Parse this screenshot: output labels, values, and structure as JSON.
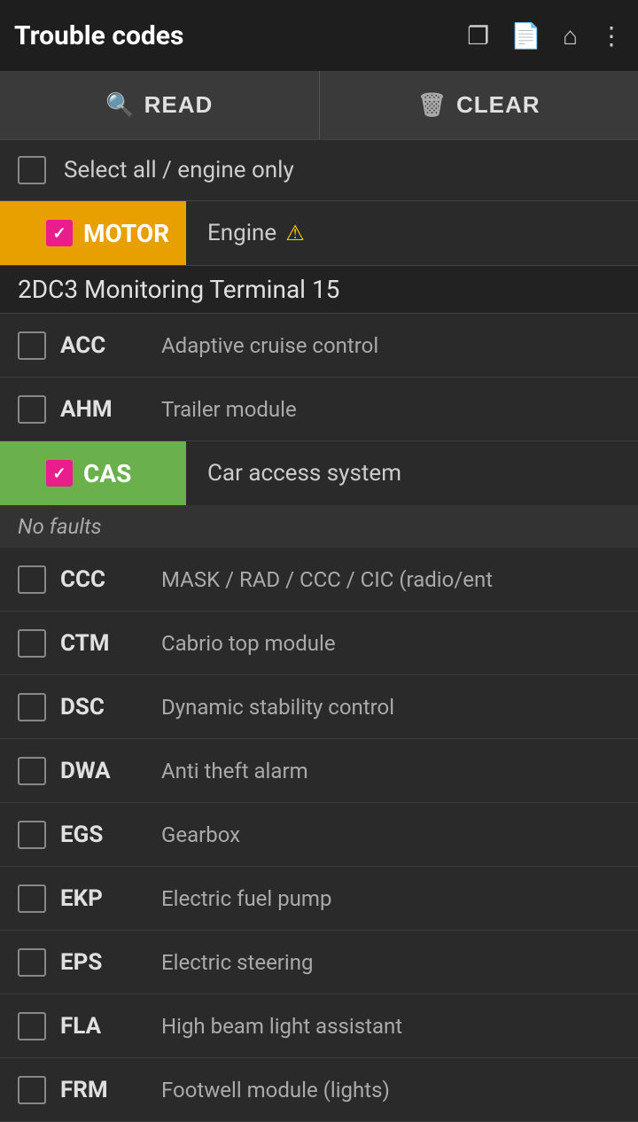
{
  "header": {
    "title": "Trouble codes",
    "icons": [
      "copy",
      "file",
      "home",
      "more"
    ]
  },
  "toolbar": {
    "read_label": "READ",
    "clear_label": "CLEAR"
  },
  "select_all": {
    "label": "Select all / engine only",
    "checked": false
  },
  "motor_module": {
    "code": "MOTOR",
    "description": "Engine",
    "checked": true,
    "has_warning": true,
    "section_title": "2DC3 Monitoring Terminal 15"
  },
  "items_before_cas": [
    {
      "code": "ACC",
      "description": "Adaptive cruise control",
      "checked": false
    },
    {
      "code": "AHM",
      "description": "Trailer module",
      "checked": false
    }
  ],
  "cas_module": {
    "code": "CAS",
    "description": "Car access system",
    "checked": true,
    "status": "No faults"
  },
  "items_after_cas": [
    {
      "code": "CCC",
      "description": "MASK / RAD / CCC / CIC (radio/ent",
      "checked": false
    },
    {
      "code": "CTM",
      "description": "Cabrio top module",
      "checked": false
    },
    {
      "code": "DSC",
      "description": "Dynamic stability control",
      "checked": false
    },
    {
      "code": "DWA",
      "description": "Anti theft alarm",
      "checked": false
    },
    {
      "code": "EGS",
      "description": "Gearbox",
      "checked": false
    },
    {
      "code": "EKP",
      "description": "Electric fuel pump",
      "checked": false
    },
    {
      "code": "EPS",
      "description": "Electric steering",
      "checked": false
    },
    {
      "code": "FLA",
      "description": "High beam light assistant",
      "checked": false
    },
    {
      "code": "FRM",
      "description": "Footwell module (lights)",
      "checked": false
    }
  ]
}
